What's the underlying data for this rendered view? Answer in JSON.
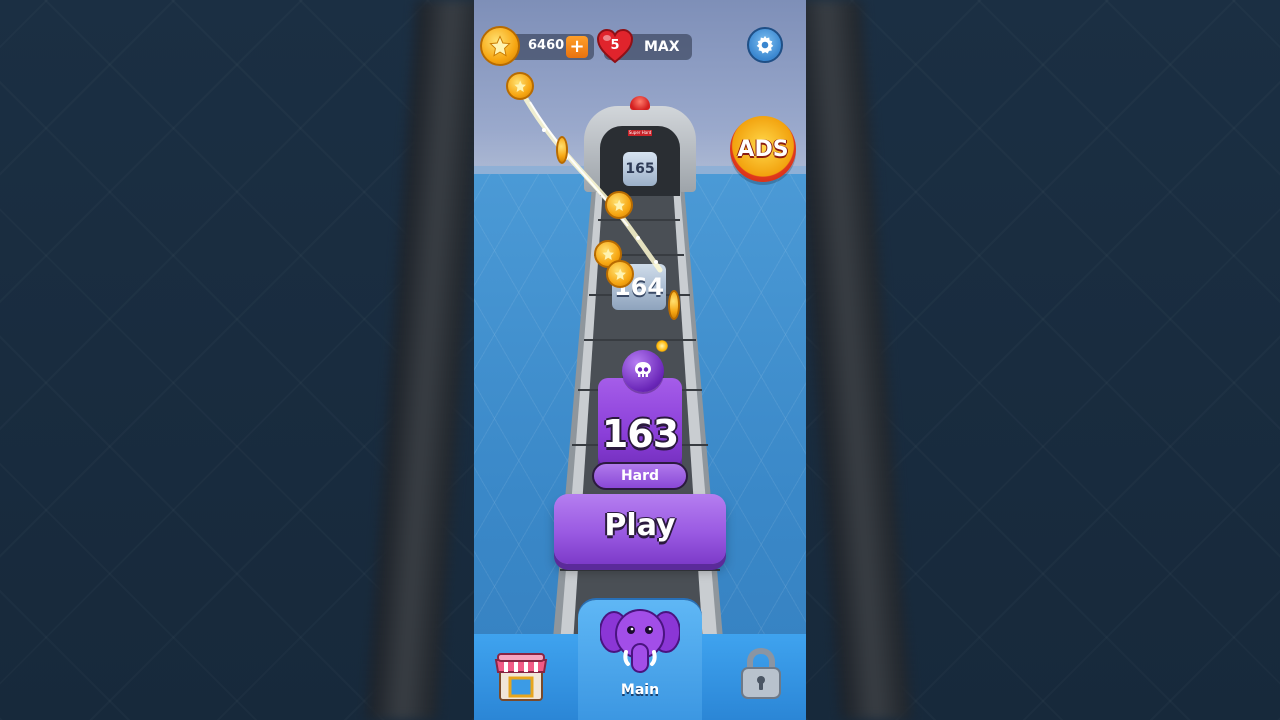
{
  "hud": {
    "coins": "6460",
    "plus": "+",
    "lives": "5",
    "lives_status": "MAX"
  },
  "ads_button": {
    "label": "ADS"
  },
  "track": {
    "levels": [
      "165",
      "164"
    ],
    "current_level": "163",
    "difficulty": "Hard",
    "gate_sign": "Super Hard"
  },
  "play_button": {
    "label": "Play"
  },
  "bottom_nav": {
    "tabs": [
      {
        "label": "",
        "icon": "shop-icon"
      },
      {
        "label": "Main",
        "icon": "elephant-icon"
      },
      {
        "label": "",
        "icon": "lock-icon"
      }
    ]
  },
  "colors": {
    "accent_purple": "#9a5ae2",
    "coin_gold": "#f7a713",
    "nav_blue": "#3fa3ef"
  }
}
